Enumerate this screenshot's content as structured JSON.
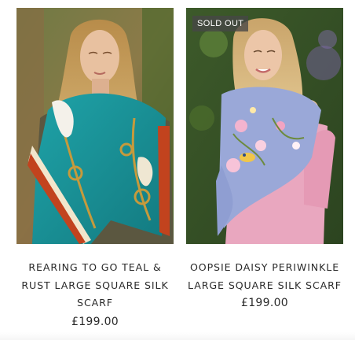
{
  "products": [
    {
      "title": "REARING TO GO TEAL & RUST LARGE SQUARE SILK SCARF",
      "price": "£199.00",
      "badge": "",
      "image_desc": "model-teal-scarf"
    },
    {
      "title": "OOPSIE DAISY PERIWINKLE LARGE SQUARE SILK SCARF",
      "price": "£199.00",
      "badge": "SOLD OUT",
      "image_desc": "model-periwinkle-scarf"
    }
  ],
  "colors": {
    "teal": "#1f8a92",
    "rust": "#b84a24",
    "periwinkle": "#9aa8d8",
    "pink_coat": "#e9a7bf",
    "foliage": "#3f5a2c"
  }
}
